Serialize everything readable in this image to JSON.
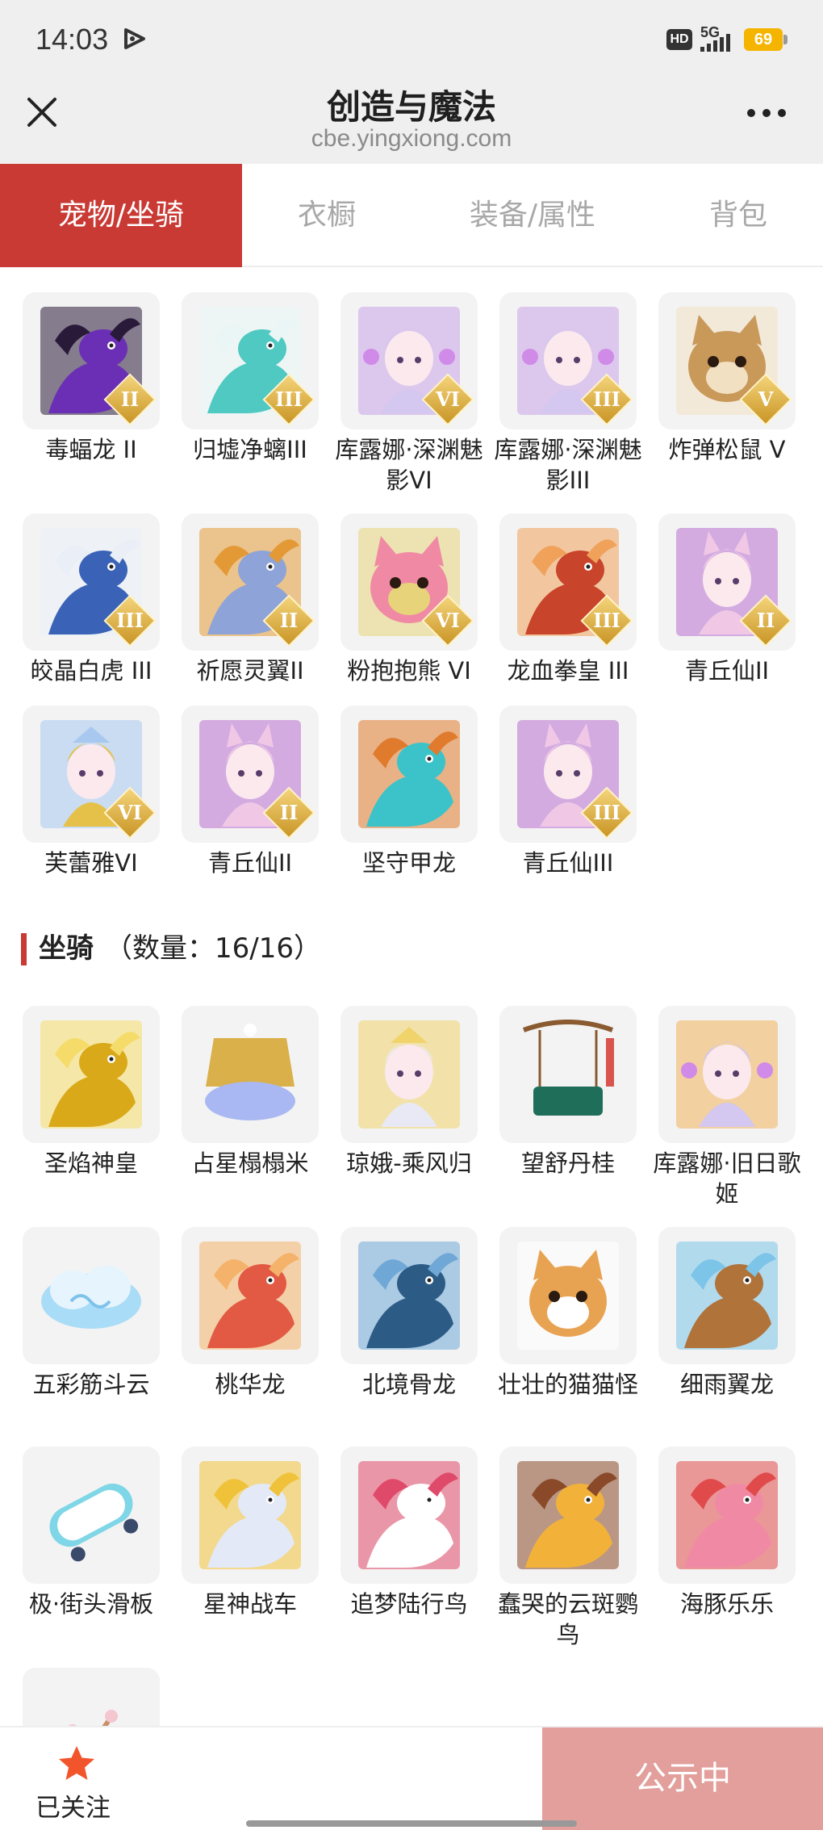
{
  "status_bar": {
    "time": "14:03",
    "hd": "HD",
    "network": "5G",
    "battery": "69"
  },
  "header": {
    "title": "创造与魔法",
    "url": "cbe.yingxiong.com",
    "close_icon": "close-icon",
    "more_icon": "more-icon"
  },
  "tabs": [
    {
      "label": "宠物/坐骑",
      "active": true
    },
    {
      "label": "衣橱",
      "active": false
    },
    {
      "label": "装备/属性",
      "active": false
    },
    {
      "label": "背包",
      "active": false
    }
  ],
  "pets": {
    "items": [
      {
        "name": "毒蝠龙 II",
        "badge": "II",
        "theme": "dragon-purple",
        "colors": [
          "#6a2fb5",
          "#2a1a3a"
        ]
      },
      {
        "name": "归墟净螭III",
        "badge": "III",
        "theme": "serpent-teal",
        "colors": [
          "#4fc9c2",
          "#eaf6f5"
        ]
      },
      {
        "name": "库露娜·深渊魅影VI",
        "badge": "VI",
        "theme": "spirit-pink",
        "colors": [
          "#d4c7f0",
          "#c9a2e8"
        ]
      },
      {
        "name": "库露娜·深渊魅影III",
        "badge": "III",
        "theme": "spirit-pink",
        "colors": [
          "#d4c7f0",
          "#c9a2e8"
        ]
      },
      {
        "name": "炸弹松鼠 V",
        "badge": "V",
        "theme": "squirrel",
        "colors": [
          "#c9995a",
          "#f1e0c2"
        ]
      },
      {
        "name": "皎晶白虎 III",
        "badge": "III",
        "theme": "tiger",
        "colors": [
          "#3a63b8",
          "#e9eef7"
        ]
      },
      {
        "name": "祈愿灵翼II",
        "badge": "II",
        "theme": "eagle",
        "colors": [
          "#8ea3d8",
          "#e39a36"
        ]
      },
      {
        "name": "粉抱抱熊 VI",
        "badge": "VI",
        "theme": "bear",
        "colors": [
          "#f08aa4",
          "#e7d37a"
        ]
      },
      {
        "name": "龙血拳皇 III",
        "badge": "III",
        "theme": "beast-red",
        "colors": [
          "#c8442a",
          "#f0a25b"
        ]
      },
      {
        "name": "青丘仙II",
        "badge": "II",
        "theme": "fox-fairy",
        "colors": [
          "#f0c8e6",
          "#b86fd0"
        ]
      },
      {
        "name": "芙蕾雅VI",
        "badge": "VI",
        "theme": "valkyrie",
        "colors": [
          "#e6c14a",
          "#a8c8ef"
        ]
      },
      {
        "name": "青丘仙II",
        "badge": "II",
        "theme": "fox-fairy",
        "colors": [
          "#f0c8e6",
          "#b86fd0"
        ]
      },
      {
        "name": "坚守甲龙",
        "badge": "",
        "theme": "ankylo",
        "colors": [
          "#3cc3c9",
          "#e07a2c"
        ]
      },
      {
        "name": "青丘仙III",
        "badge": "III",
        "theme": "fox-fairy",
        "colors": [
          "#f0c8e6",
          "#b86fd0"
        ]
      }
    ]
  },
  "mounts": {
    "title": "坐骑",
    "count_text": "（数量：16/16）",
    "items": [
      {
        "name": "圣焰神皇",
        "theme": "phoenix-gold",
        "colors": [
          "#d9a91a",
          "#f5dc6a"
        ]
      },
      {
        "name": "占星榻榻米",
        "theme": "carpet",
        "colors": [
          "#d9b04a",
          "#a9b8f2"
        ]
      },
      {
        "name": "琼娥-乘风归",
        "theme": "fairy-white",
        "colors": [
          "#e9e9f5",
          "#f0d36b"
        ]
      },
      {
        "name": "望舒丹桂",
        "theme": "swing",
        "colors": [
          "#1f6e5a",
          "#d9534f"
        ]
      },
      {
        "name": "库露娜·旧日歌姬",
        "theme": "spirit-pink",
        "colors": [
          "#d4c7f0",
          "#f0b35a"
        ]
      },
      {
        "name": "五彩筋斗云",
        "theme": "cloud",
        "colors": [
          "#a9dcf7",
          "#e6f4fd"
        ]
      },
      {
        "name": "桃华龙",
        "theme": "dragon-peach",
        "colors": [
          "#e25a43",
          "#f4b26a"
        ]
      },
      {
        "name": "北境骨龙",
        "theme": "dragon-ice",
        "colors": [
          "#2c5c86",
          "#6fa8d6"
        ]
      },
      {
        "name": "壮壮的猫猫怪",
        "theme": "cat",
        "colors": [
          "#e8a352",
          "#ffffff"
        ]
      },
      {
        "name": "细雨翼龙",
        "theme": "pterosaur",
        "colors": [
          "#b0733a",
          "#7cc4e8"
        ]
      },
      {
        "name": "极·街头滑板",
        "theme": "skateboard",
        "colors": [
          "#7fd6e6",
          "#ffffff"
        ]
      },
      {
        "name": "星神战车",
        "theme": "horse",
        "colors": [
          "#e3e9f7",
          "#f0c23a"
        ]
      },
      {
        "name": "追梦陆行鸟",
        "theme": "bird-white",
        "colors": [
          "#ffffff",
          "#e04a6a"
        ]
      },
      {
        "name": "蠢哭的云斑鹦鸟",
        "theme": "parrot",
        "colors": [
          "#f2b23a",
          "#8a4a2a"
        ]
      },
      {
        "name": "海豚乐乐",
        "theme": "dolphin",
        "colors": [
          "#f08aa4",
          "#e04a4a"
        ]
      },
      {
        "name": "",
        "theme": "blossom",
        "colors": [
          "#c8906a",
          "#f4c6d0"
        ]
      }
    ]
  },
  "bottom_bar": {
    "follow_label": "已关注",
    "publish_label": "公示中",
    "star_color": "#f2552c"
  }
}
